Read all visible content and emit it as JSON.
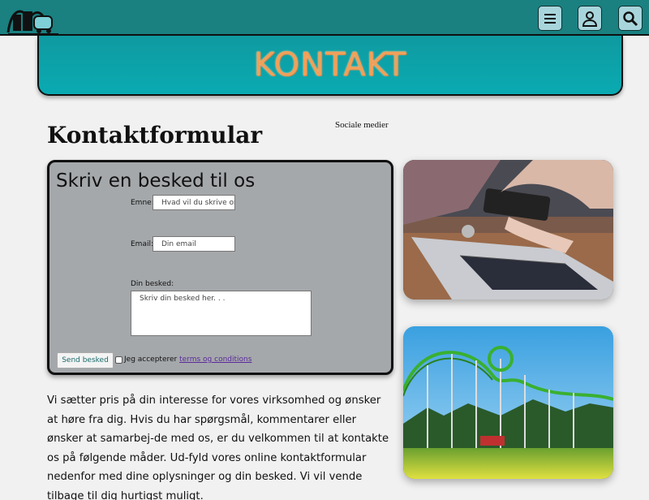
{
  "header": {
    "menu_icon": "hamburger-menu-icon",
    "user_icon": "user-icon",
    "search_icon": "search-icon",
    "logo_icon": "rollercoaster-logo-icon"
  },
  "banner": {
    "title": "KONTAKT"
  },
  "page": {
    "heading": "Kontaktformular",
    "social_label": "Sociale medier"
  },
  "form": {
    "title": "Skriv en besked til os",
    "subject_label": "Emne:",
    "subject_placeholder": "Hvad vil du skrive om",
    "email_label": "Email:",
    "email_placeholder": "Din email",
    "message_label": "Din besked:",
    "message_placeholder": "Skriv din besked her. . .",
    "send_label": "Send besked",
    "accept_text": "Jeg accepterer",
    "terms_link": "terms og conditions"
  },
  "body_text": "Vi sætter pris på din interesse for vores virksomhed og ønsker at høre fra dig. Hvis du har spørgsmål, kommentarer eller ønsker at samarbej-de med os, er du velkommen til at kontakte os på følgende måder. Ud-fyld vores online kontaktformular nedenfor med dine oplysninger og din besked. Vi vil vende tilbage til dig hurtigst muligt.",
  "colors": {
    "topbar": "#1a8080",
    "banner": "#0aaab2",
    "banner_text": "#f0a05a",
    "form_bg": "#a5a8ab"
  }
}
